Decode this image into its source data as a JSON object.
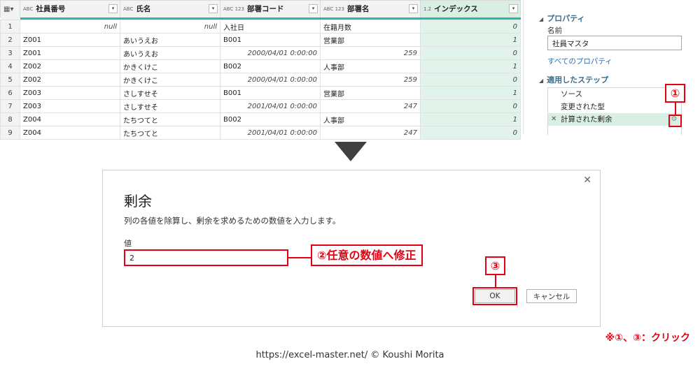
{
  "grid": {
    "columns": [
      {
        "type": "ABC",
        "name": "社員番号"
      },
      {
        "type": "ABC",
        "name": "氏名"
      },
      {
        "type": "ABC 123",
        "name": "部署コード"
      },
      {
        "type": "ABC 123",
        "name": "部署名"
      },
      {
        "type": "1.2",
        "name": "インデックス"
      }
    ],
    "rows": [
      {
        "n": "1",
        "c1": "",
        "c2": "null",
        "c3": "入社日",
        "c4": "在籍月数",
        "c5": "0"
      },
      {
        "n": "2",
        "c1": "Z001",
        "c2": "あいうえお",
        "c3": "B001",
        "c4": "営業部",
        "c5": "1"
      },
      {
        "n": "3",
        "c1": "Z001",
        "c2": "あいうえお",
        "c3": "2000/04/01 0:00:00",
        "c4": "259",
        "c5": "0"
      },
      {
        "n": "4",
        "c1": "Z002",
        "c2": "かきくけこ",
        "c3": "B002",
        "c4": "人事部",
        "c5": "1"
      },
      {
        "n": "5",
        "c1": "Z002",
        "c2": "かきくけこ",
        "c3": "2000/04/01 0:00:00",
        "c4": "259",
        "c5": "0"
      },
      {
        "n": "6",
        "c1": "Z003",
        "c2": "さしすせそ",
        "c3": "B001",
        "c4": "営業部",
        "c5": "1"
      },
      {
        "n": "7",
        "c1": "Z003",
        "c2": "さしすせそ",
        "c3": "2001/04/01 0:00:00",
        "c4": "247",
        "c5": "0"
      },
      {
        "n": "8",
        "c1": "Z004",
        "c2": "たちつてと",
        "c3": "B002",
        "c4": "人事部",
        "c5": "1"
      },
      {
        "n": "9",
        "c1": "Z004",
        "c2": "たちつてと",
        "c3": "2001/04/01 0:00:00",
        "c4": "247",
        "c5": "0"
      }
    ],
    "first_row_c1": "null"
  },
  "settings": {
    "properties_title": "プロパティ",
    "name_label": "名前",
    "name_value": "社員マスタ",
    "all_properties_link": "すべてのプロパティ",
    "steps_title": "適用したステップ",
    "steps": [
      "ソース",
      "変更された型",
      "計算された剰余"
    ]
  },
  "dialog": {
    "title": "剰余",
    "description": "列の各値を除算し、剰余を求めるための数値を入力します。",
    "value_label": "値",
    "value": "2",
    "ok_label": "OK",
    "cancel_label": "キャンセル"
  },
  "annotations": {
    "circle1": "①",
    "circle3": "③",
    "edit_note": "②任意の数値へ修正",
    "click_note": "※①、③：クリック"
  },
  "credit": "https://excel-master.net/  © Koushi Morita",
  "colors": {
    "accent_red": "#e60012",
    "teal_bar": "#2ab7a9",
    "selected_green": "#e1f3ea"
  }
}
